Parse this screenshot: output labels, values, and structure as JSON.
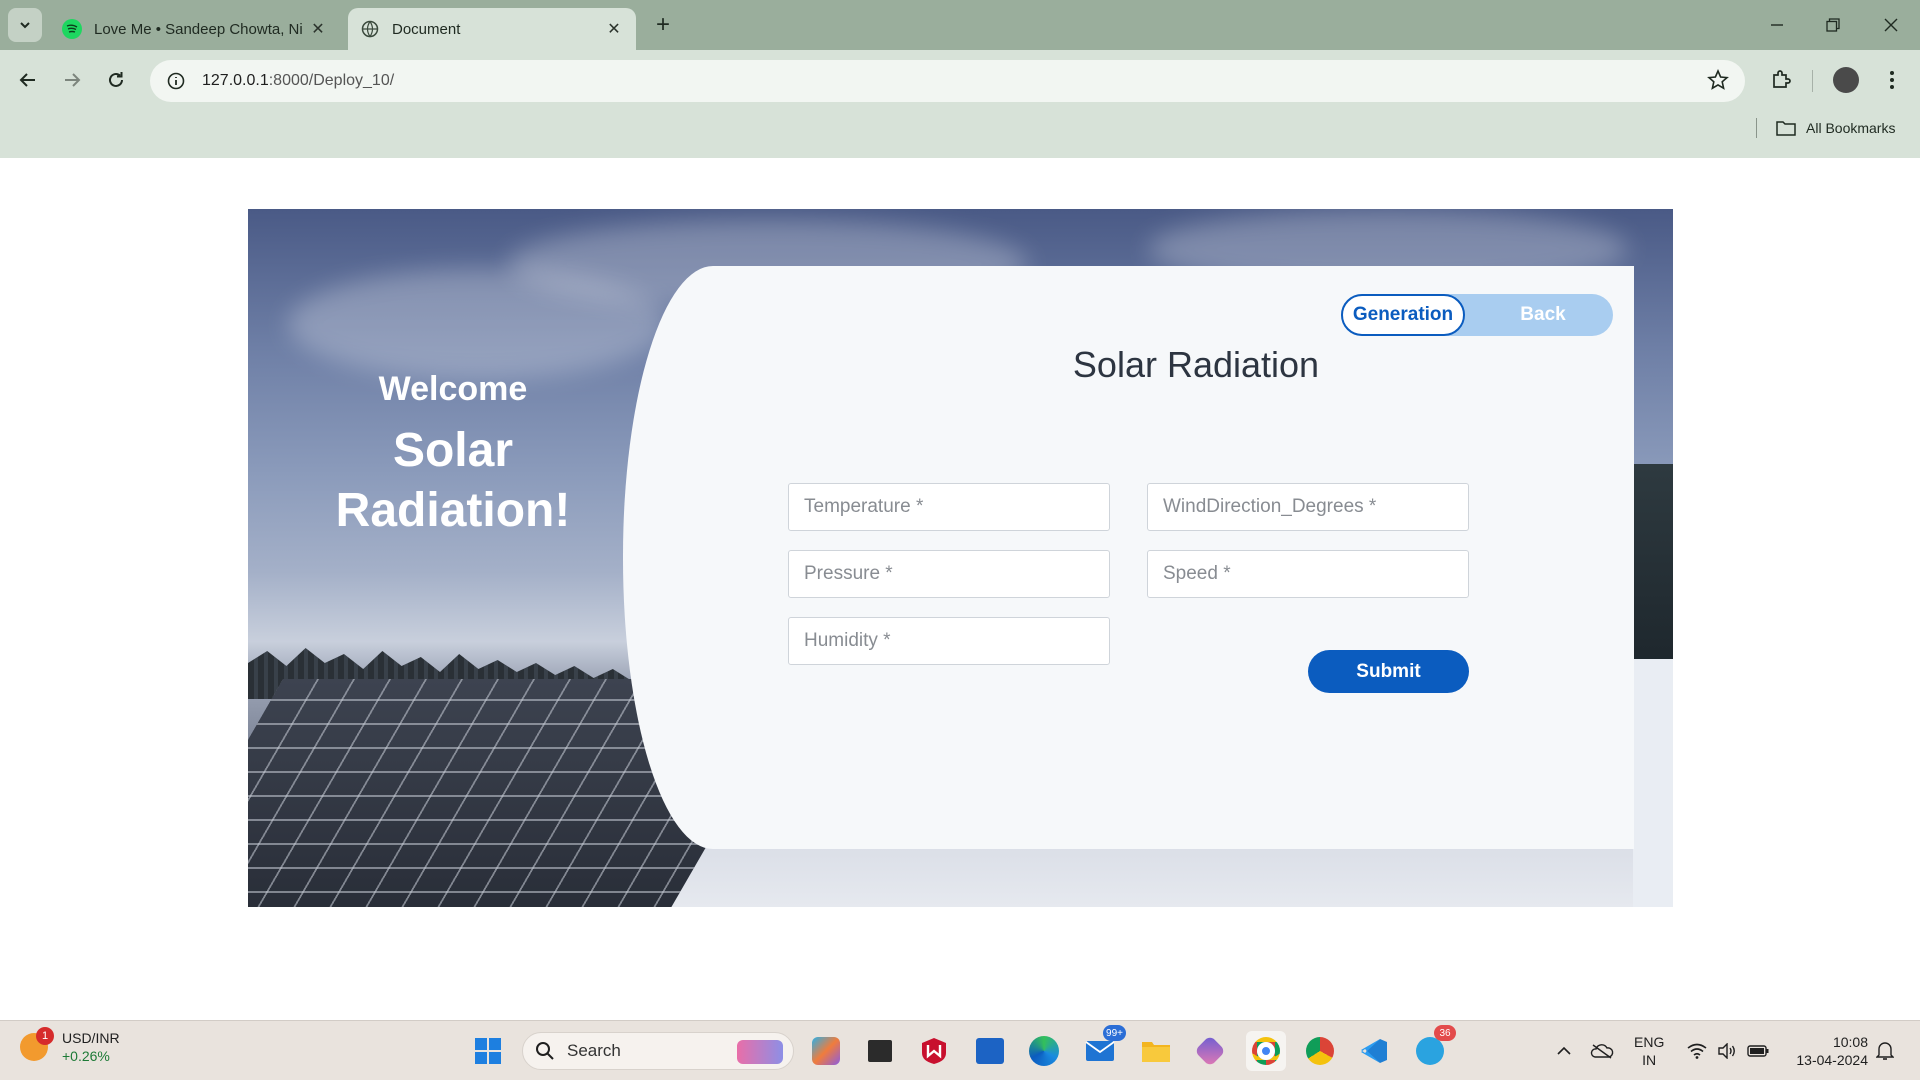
{
  "browser": {
    "tabs": [
      {
        "title": "Love Me • Sandeep Chowta, Ni",
        "favicon": "spotify-icon",
        "active": false
      },
      {
        "title": "Document",
        "favicon": "globe-icon",
        "active": true
      }
    ],
    "url_host": "127.0.0.1",
    "url_path": ":8000/Deploy_10/",
    "bookmarks_label": "All Bookmarks"
  },
  "hero": {
    "welcome": "Welcome",
    "headline_line1": "Solar",
    "headline_line2": "Radiation!"
  },
  "form": {
    "title": "Solar Radiation",
    "toggle_generation": "Generation",
    "toggle_back": "Back",
    "fields": {
      "temperature": "Temperature *",
      "wind_direction": "WindDirection_Degrees *",
      "pressure": "Pressure *",
      "speed": "Speed *",
      "humidity": "Humidity *"
    },
    "submit_label": "Submit",
    "accent_color": "#0b5cbf"
  },
  "taskbar": {
    "ticker_symbol": "USD/INR",
    "ticker_change": "+0.26%",
    "ticker_badge": "1",
    "search_label": "Search",
    "mail_badge": "99+",
    "telegram_badge": "36",
    "lang_line1": "ENG",
    "lang_line2": "IN",
    "time": "10:08",
    "date": "13-04-2024"
  }
}
